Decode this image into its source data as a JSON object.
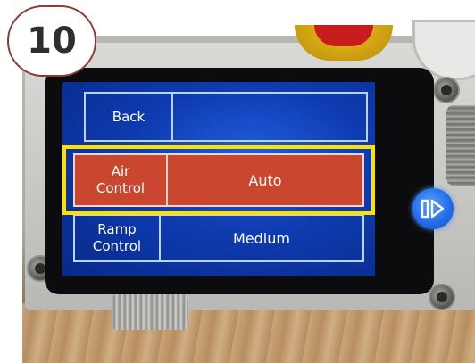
{
  "step": {
    "number": "10"
  },
  "screen": {
    "rows": [
      {
        "label": "Back",
        "value": "",
        "selected": false
      },
      {
        "label": "Air\nControl",
        "value": "Auto",
        "selected": true
      },
      {
        "label": "Ramp\nControl",
        "value": "Medium",
        "selected": false
      }
    ]
  },
  "next_button": {
    "icon": "next-page-icon"
  },
  "colors": {
    "selected_row": "#c9472f",
    "screen_blue": "#0e3bb0",
    "highlight": "#ffe100",
    "badge_border": "#8a3b36"
  }
}
